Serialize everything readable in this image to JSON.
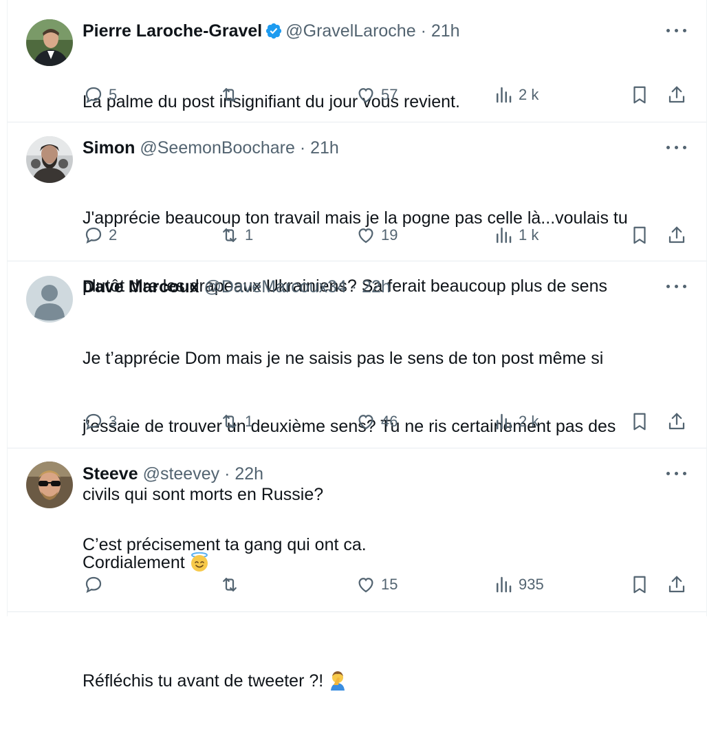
{
  "tweets": [
    {
      "name": "Pierre Laroche-Gravel",
      "verified": true,
      "handle": "@GravelLaroche",
      "separator": "·",
      "time": "21h",
      "lines": [
        "La palme du post insignifiant du jour vous revient."
      ],
      "replies": "5",
      "retweets": "",
      "likes": "57",
      "views": "2 k"
    },
    {
      "name": "Simon",
      "verified": false,
      "handle": "@SeemonBoochare",
      "separator": "·",
      "time": "21h",
      "lines": [
        "J'apprécie beaucoup ton travail mais je la pogne pas celle là...voulais tu",
        "plutôt dire les drapeaux Ukrainiens? Sa ferait beaucoup plus de sens"
      ],
      "replies": "2",
      "retweets": "1",
      "likes": "19",
      "views": "1 k"
    },
    {
      "name": "Dave Marcoux",
      "verified": false,
      "handle": "@DaveMarcoux34",
      "separator": "·",
      "time": "22h",
      "lines": [
        "Je t’apprécie Dom mais je ne saisis pas le sens de ton post même si",
        "j’essaie de trouver un deuxième sens? Tu ne ris certainement pas des",
        "civils qui sont morts en Russie?",
        "Cordialement"
      ],
      "emoji": "smiling-face-with-halo",
      "replies": "3",
      "retweets": "1",
      "likes": "46",
      "views": "2 k"
    },
    {
      "name": "Steeve",
      "verified": false,
      "handle": "@steevey",
      "separator": "·",
      "time": "22h",
      "lines": [
        "C’est précisement ta gang qui ont ca.",
        "",
        "Réfléchis tu avant de tweeter ?!"
      ],
      "emoji": "person-facepalming",
      "replies": "",
      "retweets": "",
      "likes": "15",
      "views": "935"
    }
  ],
  "colors": {
    "text": "#0f1419",
    "muted": "#536471",
    "verified": "#1d9bf0",
    "border": "#e7ecf0"
  }
}
